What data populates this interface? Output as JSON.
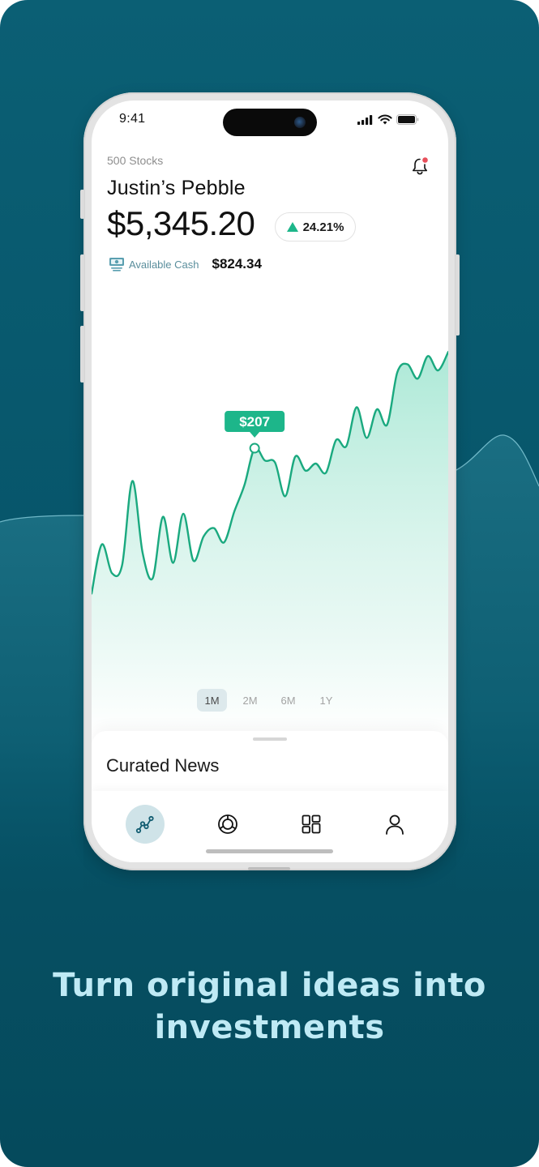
{
  "status_bar": {
    "time": "9:41",
    "icons": [
      "cellular-signal-icon",
      "wifi-icon",
      "battery-icon"
    ]
  },
  "header": {
    "subtitle": "500 Stocks",
    "portfolio_name": "Justin’s Pebble",
    "balance": "$5,345.20",
    "change_percent": "24.21%",
    "change_direction": "up",
    "notification_icon": "bell-icon",
    "has_notification": true
  },
  "cash": {
    "icon": "cash-icon",
    "label": "Available Cash",
    "value": "$824.34"
  },
  "colors": {
    "accent": "#1db68a",
    "line": "#1aa97f",
    "fill_top": "#b5ecdc",
    "background": "#07566b",
    "tagline": "#bfeaf5",
    "notification_dot": "#e8505b"
  },
  "chart_data": {
    "type": "area",
    "title": "",
    "xlabel": "",
    "ylabel": "",
    "grid": false,
    "tooltip": {
      "label": "$207",
      "index": 16
    },
    "values": [
      120,
      168,
      140,
      148,
      230,
      160,
      135,
      195,
      150,
      198,
      152,
      176,
      184,
      170,
      200,
      226,
      262,
      250,
      248,
      215,
      254,
      240,
      247,
      238,
      270,
      264,
      302,
      272,
      300,
      285,
      336,
      344,
      330,
      352,
      338,
      356
    ]
  },
  "range_tabs": [
    {
      "label": "1M",
      "active": true
    },
    {
      "label": "2M",
      "active": false
    },
    {
      "label": "6M",
      "active": false
    },
    {
      "label": "1Y",
      "active": false
    }
  ],
  "news": {
    "title": "Curated News"
  },
  "tab_bar": [
    {
      "icon": "chart-line-icon",
      "active": true
    },
    {
      "icon": "pie-chart-icon",
      "active": false
    },
    {
      "icon": "dashboard-icon",
      "active": false
    },
    {
      "icon": "profile-icon",
      "active": false
    }
  ],
  "tagline": [
    "Turn original ideas into",
    "investments"
  ]
}
